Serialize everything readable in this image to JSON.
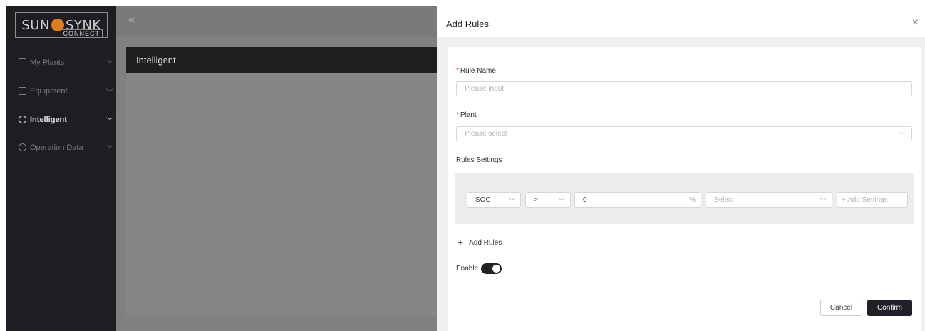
{
  "logo": {
    "text_left": "SUN",
    "text_right": "SYNK",
    "sub": "CONNECT"
  },
  "sidebar": {
    "items": [
      {
        "label": "My Plants",
        "icon": "home-icon",
        "active": false
      },
      {
        "label": "Equipment",
        "icon": "monitor-icon",
        "active": false
      },
      {
        "label": "Intelligent",
        "icon": "bulb-icon",
        "active": true
      },
      {
        "label": "Operation Data",
        "icon": "clock-icon",
        "active": false
      }
    ],
    "chevron": "﹀"
  },
  "main": {
    "collapse_icon": "«",
    "card_title": "Intelligent"
  },
  "dialog": {
    "title": "Add Rules",
    "close": "×",
    "rule_name": {
      "label": "Rule Name",
      "required_mark": "*",
      "placeholder": "Please input"
    },
    "plant": {
      "label": "Plant",
      "required_mark": "*",
      "placeholder": "Please select"
    },
    "rules_settings_label": "Rules Settings",
    "condition": {
      "param": "SOC",
      "operator": ">",
      "value": "0",
      "unit": "%",
      "select_placeholder": "Select",
      "add_settings": "+ Add Settings"
    },
    "add_rules": "Add Rules",
    "enable_label": "Enable",
    "enable_on": true,
    "cancel": "Cancel",
    "confirm": "Confirm"
  }
}
